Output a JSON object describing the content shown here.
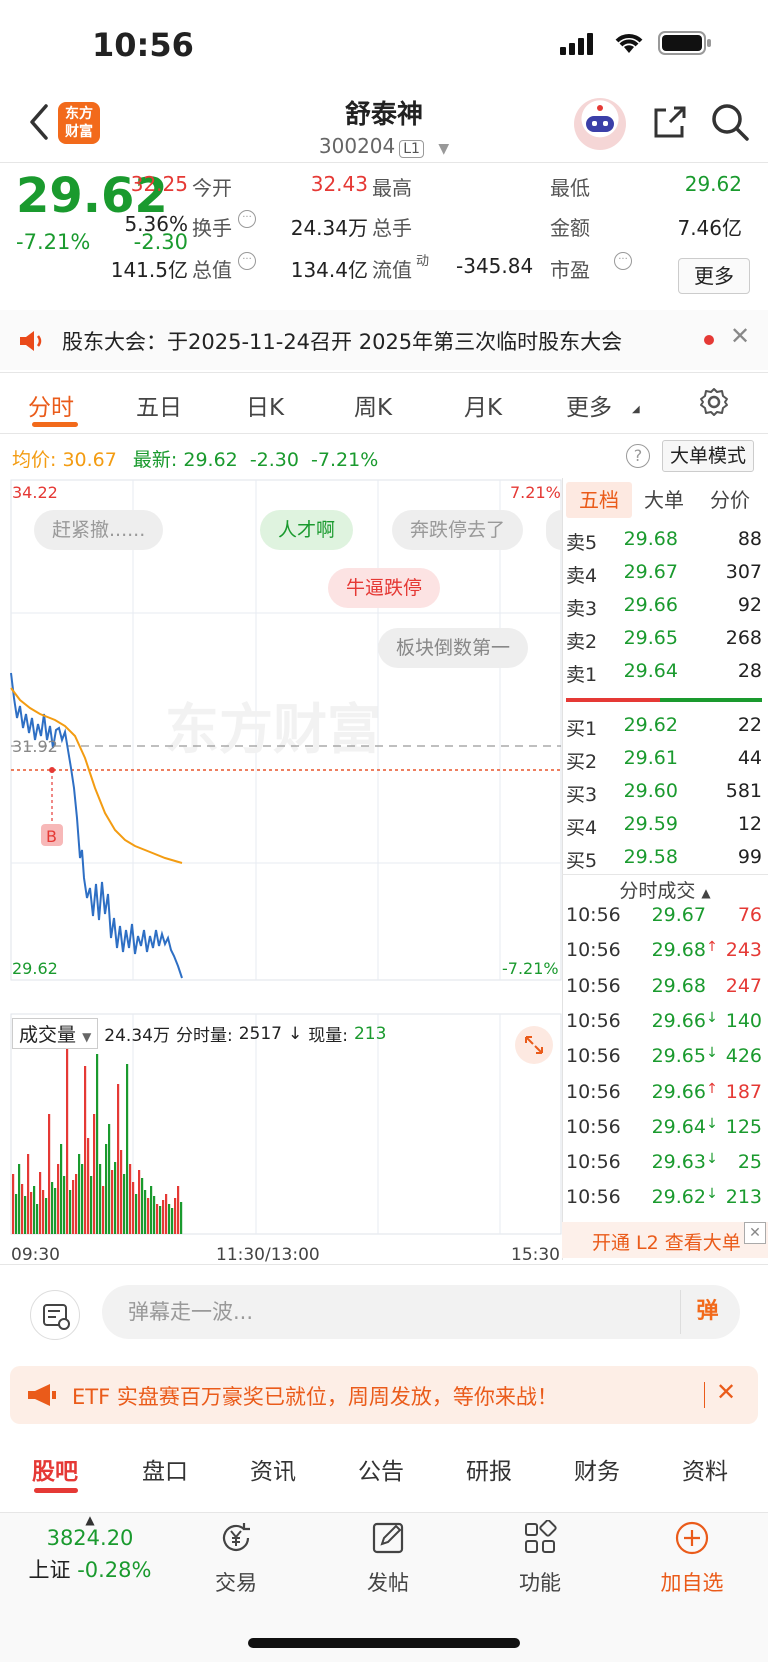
{
  "status": {
    "time": "10:56"
  },
  "header": {
    "logo_line1": "东方",
    "logo_line2": "财富",
    "title": "舒泰神",
    "code": "300204",
    "level_tag": "L1"
  },
  "quote": {
    "price": "29.62",
    "pct": "-7.21%",
    "chg": "-2.30",
    "fields": [
      {
        "label": "今开",
        "value": "32.25",
        "color": "#e53935"
      },
      {
        "label": "最高",
        "value": "32.43",
        "color": "#e53935"
      },
      {
        "label": "最低",
        "value": "29.62",
        "color": "#1a9a2e"
      },
      {
        "label": "换手",
        "value": "5.36%",
        "color": "#222"
      },
      {
        "label": "总手",
        "value": "24.34万",
        "color": "#222"
      },
      {
        "label": "金额",
        "value": "7.46亿",
        "color": "#222"
      },
      {
        "label": "总值",
        "value": "141.5亿",
        "color": "#222"
      },
      {
        "label": "流值",
        "value": "134.4亿",
        "color": "#222"
      },
      {
        "label": "市盈",
        "value": "-345.84",
        "color": "#222"
      }
    ],
    "pe_sup": "动",
    "more_label": "更多"
  },
  "notice": {
    "text": "股东大会：于2025-11-24召开 2025年第三次临时股东大会"
  },
  "tabs": [
    "分时",
    "五日",
    "日K",
    "周K",
    "月K",
    "更多"
  ],
  "info": {
    "avg_label": "均价:",
    "avg_value": "30.67",
    "latest_label": "最新:",
    "latest_value": "29.62",
    "latest_chg": "-2.30",
    "latest_pct": "-7.21%",
    "big_order_mode": "大单模式"
  },
  "chart": {
    "y_high": "34.22",
    "y_low": "29.62",
    "y_mid": "31.92",
    "pct_high": "7.21%",
    "pct_low": "-7.21%",
    "watermark": "东方财富",
    "buy_marker": "B",
    "time_start": "09:30",
    "time_mid": "11:30/13:00",
    "time_end": "15:30",
    "vol_max": "10724"
  },
  "danmu": [
    "赶紧撤......",
    "人才啊",
    "奔跌停去了",
    "牛逼跌停",
    "板块倒数第一"
  ],
  "volume_row": {
    "select": "成交量",
    "total": "24.34万",
    "minute_label": "分时量:",
    "minute_value": "2517",
    "now_label": "现量:",
    "now_value": "213"
  },
  "orderbook": {
    "tabs": [
      "五档",
      "大单",
      "分价"
    ],
    "asks": [
      {
        "label": "卖5",
        "price": "29.68",
        "vol": "88"
      },
      {
        "label": "卖4",
        "price": "29.67",
        "vol": "307"
      },
      {
        "label": "卖3",
        "price": "29.66",
        "vol": "92"
      },
      {
        "label": "卖2",
        "price": "29.65",
        "vol": "268"
      },
      {
        "label": "卖1",
        "price": "29.64",
        "vol": "28"
      }
    ],
    "bids": [
      {
        "label": "买1",
        "price": "29.62",
        "vol": "22"
      },
      {
        "label": "买2",
        "price": "29.61",
        "vol": "44"
      },
      {
        "label": "买3",
        "price": "29.60",
        "vol": "581"
      },
      {
        "label": "买4",
        "price": "29.59",
        "vol": "12"
      },
      {
        "label": "买5",
        "price": "29.58",
        "vol": "99"
      }
    ],
    "ticks_title": "分时成交",
    "ticks": [
      {
        "time": "10:56",
        "price": "29.67",
        "arrow": "",
        "vol": "76",
        "vcolor": "#e53935"
      },
      {
        "time": "10:56",
        "price": "29.68",
        "arrow": "↑",
        "vol": "243",
        "vcolor": "#e53935"
      },
      {
        "time": "10:56",
        "price": "29.68",
        "arrow": "",
        "vol": "247",
        "vcolor": "#e53935"
      },
      {
        "time": "10:56",
        "price": "29.66",
        "arrow": "↓",
        "vol": "140",
        "vcolor": "#1a9a2e"
      },
      {
        "time": "10:56",
        "price": "29.65",
        "arrow": "↓",
        "vol": "426",
        "vcolor": "#1a9a2e"
      },
      {
        "time": "10:56",
        "price": "29.66",
        "arrow": "↑",
        "vol": "187",
        "vcolor": "#e53935"
      },
      {
        "time": "10:56",
        "price": "29.64",
        "arrow": "↓",
        "vol": "125",
        "vcolor": "#1a9a2e"
      },
      {
        "time": "10:56",
        "price": "29.63",
        "arrow": "↓",
        "vol": "25",
        "vcolor": "#1a9a2e"
      },
      {
        "time": "10:56",
        "price": "29.62",
        "arrow": "↓",
        "vol": "213",
        "vcolor": "#1a9a2e"
      }
    ],
    "l2_label": "开通 L2 查看大单"
  },
  "comment": {
    "placeholder": "弹幕走一波...",
    "danmu_btn": "弹"
  },
  "promo": {
    "text": "ETF 实盘赛百万豪奖已就位，周周发放，等你来战！"
  },
  "bottom_tabs": [
    "股吧",
    "盘口",
    "资讯",
    "公告",
    "研报",
    "财务",
    "资料"
  ],
  "bottom_nav": {
    "index_value": "3824.20",
    "index_name": "上证",
    "index_pct": "-0.28%",
    "items": [
      "交易",
      "发帖",
      "功能",
      "加自选"
    ]
  },
  "colors": {
    "up": "#e53935",
    "down": "#1a9a2e",
    "accent": "#f26a1b",
    "avg_line": "#f39c12",
    "price_line": "#2e6fc4"
  }
}
